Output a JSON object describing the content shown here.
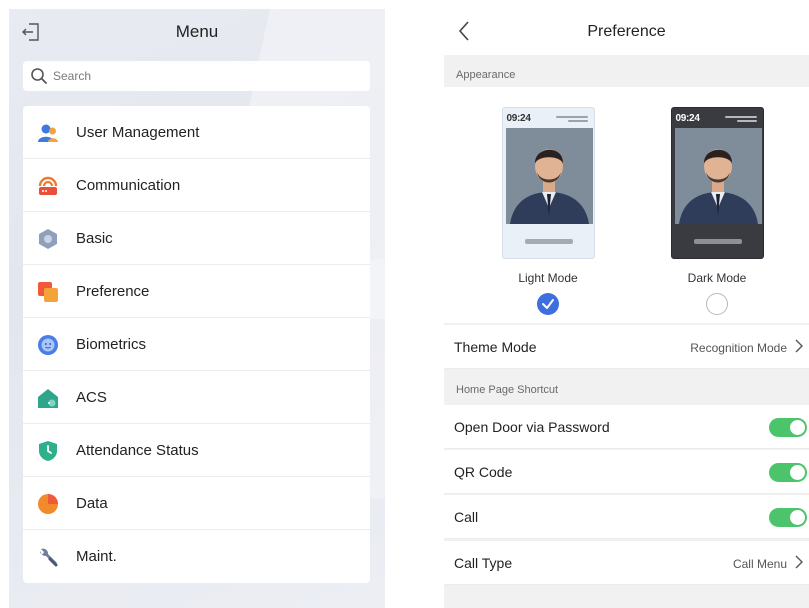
{
  "menu": {
    "title": "Menu",
    "search_placeholder": "Search",
    "items": [
      {
        "label": "User Management",
        "icon": "user-management-icon"
      },
      {
        "label": "Communication",
        "icon": "communication-icon"
      },
      {
        "label": "Basic",
        "icon": "basic-settings-icon"
      },
      {
        "label": "Preference",
        "icon": "preference-icon"
      },
      {
        "label": "Biometrics",
        "icon": "biometrics-icon"
      },
      {
        "label": "ACS",
        "icon": "acs-icon"
      },
      {
        "label": "Attendance Status",
        "icon": "attendance-status-icon"
      },
      {
        "label": "Data",
        "icon": "data-icon"
      },
      {
        "label": "Maint.",
        "icon": "maintenance-icon"
      }
    ]
  },
  "preference": {
    "title": "Preference",
    "appearance_label": "Appearance",
    "preview_time": "09:24",
    "light_mode_label": "Light Mode",
    "dark_mode_label": "Dark Mode",
    "selected_mode": "Light Mode",
    "theme_mode": {
      "label": "Theme Mode",
      "value": "Recognition Mode"
    },
    "home_shortcut_label": "Home Page Shortcut",
    "shortcuts": [
      {
        "label": "Open Door via Password",
        "enabled": true
      },
      {
        "label": "QR Code",
        "enabled": true
      },
      {
        "label": "Call",
        "enabled": true
      }
    ],
    "call_type": {
      "label": "Call Type",
      "value": "Call Menu"
    }
  },
  "colors": {
    "accent_blue": "#3d6fe0",
    "toggle_on": "#4bc46c"
  }
}
